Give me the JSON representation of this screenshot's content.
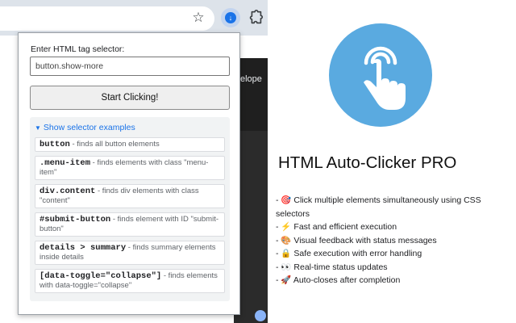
{
  "browser": {
    "star_icon": "star-icon",
    "extension_icon": "auto-clicker-extension-icon",
    "puzzle_icon": "puzzle-icon",
    "page_fragment_text": "elope"
  },
  "popup": {
    "selector_label": "Enter HTML tag selector:",
    "selector_value": "button.show-more",
    "start_button_label": "Start Clicking!",
    "examples_toggle_label": "Show selector examples",
    "examples": [
      {
        "code": "button",
        "desc": " - finds all button elements"
      },
      {
        "code": ".menu-item",
        "desc": " - finds elements with class \"menu-item\""
      },
      {
        "code": "div.content",
        "desc": " - finds div elements with class \"content\""
      },
      {
        "code": "#submit-button",
        "desc": " - finds element with ID \"submit-button\""
      },
      {
        "code": "details > summary",
        "desc": " - finds summary elements inside details"
      },
      {
        "code": "[data-toggle=\"collapse\"]",
        "desc": " - finds elements with data-toggle=\"collapse\""
      }
    ]
  },
  "brand": {
    "title": "HTML Auto-Clicker PRO",
    "logo_icon": "tap-hand-icon",
    "colors": {
      "logo_circle": "#5aaae0",
      "logo_ring": "#ffffff"
    },
    "features": [
      "- 🎯 Click multiple elements simultaneously using CSS selectors",
      "- ⚡ Fast and efficient execution",
      "- 🎨 Visual feedback with status messages",
      "- 🔒 Safe execution with error handling",
      "- 👀 Real-time status updates",
      "- 🚀 Auto-closes after completion"
    ]
  }
}
